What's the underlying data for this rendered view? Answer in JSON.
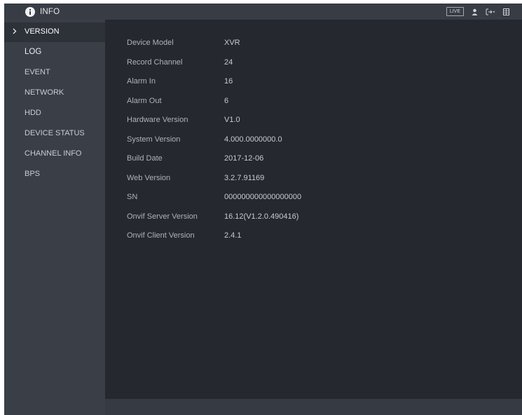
{
  "header": {
    "title": "INFO",
    "title_icon": "info-icon",
    "live_label": "LIVE",
    "right_icons": [
      "user-icon",
      "logout-icon",
      "grid-icon"
    ]
  },
  "sidebar": {
    "items": [
      {
        "label": "VERSION",
        "active": true
      },
      {
        "label": "LOG",
        "active": false
      },
      {
        "label": "EVENT",
        "active": false
      },
      {
        "label": "NETWORK",
        "active": false
      },
      {
        "label": "HDD",
        "active": false
      },
      {
        "label": "DEVICE STATUS",
        "active": false
      },
      {
        "label": "CHANNEL INFO",
        "active": false
      },
      {
        "label": "BPS",
        "active": false
      }
    ]
  },
  "version_info": {
    "rows": [
      {
        "label": "Device Model",
        "value": "XVR"
      },
      {
        "label": "Record Channel",
        "value": "24"
      },
      {
        "label": "Alarm In",
        "value": "16"
      },
      {
        "label": "Alarm Out",
        "value": "6"
      },
      {
        "label": "Hardware Version",
        "value": "V1.0"
      },
      {
        "label": "System Version",
        "value": "4.000.0000000.0"
      },
      {
        "label": "Build Date",
        "value": "2017-12-06"
      },
      {
        "label": "Web Version",
        "value": "3.2.7.91169"
      },
      {
        "label": "SN",
        "value": "000000000000000000"
      },
      {
        "label": "Onvif Server Version",
        "value": "16.12(V1.2.0.490416)"
      },
      {
        "label": "Onvif Client Version",
        "value": "2.4.1"
      }
    ]
  },
  "colors": {
    "background": "#25282e",
    "sidebar": "#3a3e47",
    "topbar": "#383c45"
  }
}
